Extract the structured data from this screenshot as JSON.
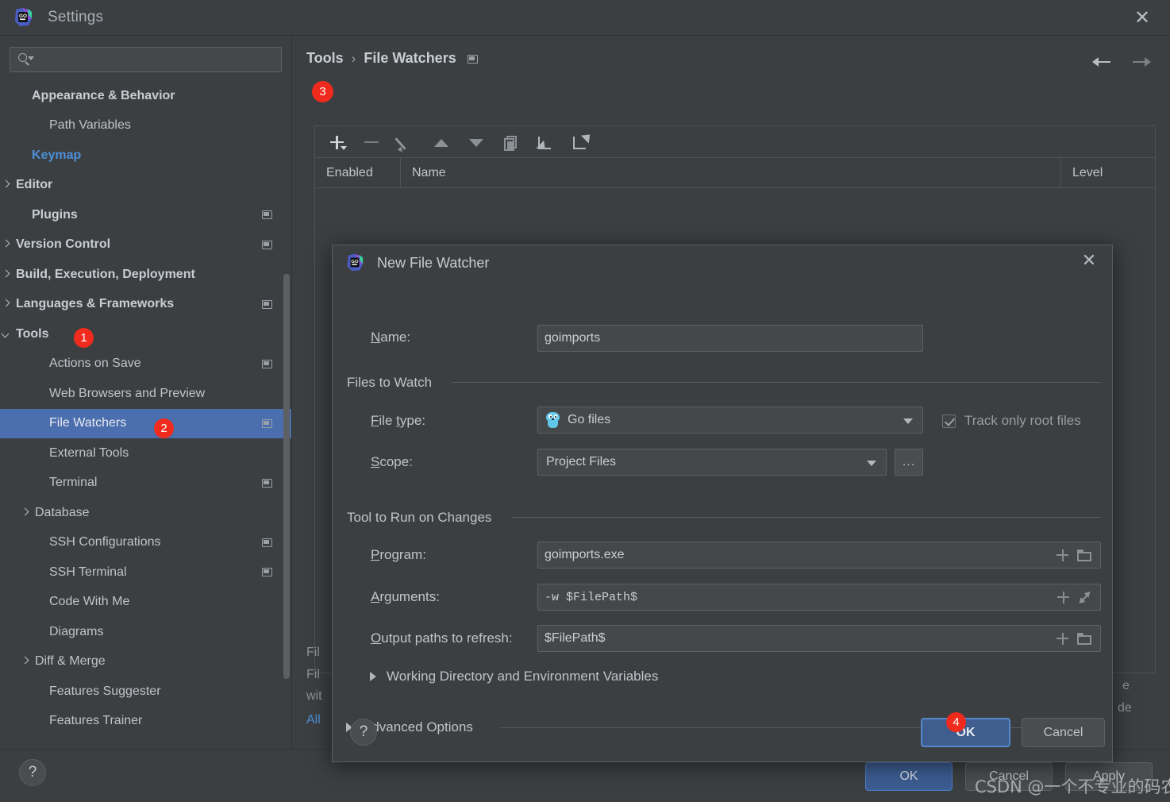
{
  "window": {
    "title": "Settings",
    "logo_icon": "goland-logo-icon",
    "close_icon": "close-icon"
  },
  "sidebar": {
    "search": {
      "placeholder": "",
      "value": "",
      "icon": "search-icon"
    },
    "items": [
      {
        "label": "Appearance & Behavior",
        "style": "bold",
        "arrow": "none",
        "indent": 30,
        "badge": false
      },
      {
        "label": "Path Variables",
        "style": "normal",
        "arrow": "none",
        "indent": 52,
        "badge": false
      },
      {
        "label": "Keymap",
        "style": "link",
        "arrow": "none",
        "indent": 30,
        "badge": false
      },
      {
        "label": "Editor",
        "style": "bold",
        "arrow": "right",
        "indent": 10,
        "badge": false
      },
      {
        "label": "Plugins",
        "style": "bold",
        "arrow": "none",
        "indent": 30,
        "badge": true
      },
      {
        "label": "Version Control",
        "style": "bold",
        "arrow": "right",
        "indent": 10,
        "badge": true
      },
      {
        "label": "Build, Execution, Deployment",
        "style": "bold",
        "arrow": "right",
        "indent": 10,
        "badge": false
      },
      {
        "label": "Languages & Frameworks",
        "style": "bold",
        "arrow": "right",
        "indent": 10,
        "badge": true
      },
      {
        "label": "Tools",
        "style": "bold",
        "arrow": "down",
        "indent": 10,
        "badge": false,
        "step": "1"
      },
      {
        "label": "Actions on Save",
        "style": "normal",
        "arrow": "none",
        "indent": 52,
        "badge": true
      },
      {
        "label": "Web Browsers and Preview",
        "style": "normal",
        "arrow": "none",
        "indent": 52,
        "badge": false
      },
      {
        "label": "File Watchers",
        "style": "normal",
        "arrow": "none",
        "indent": 52,
        "badge": true,
        "selected": true,
        "step": "2"
      },
      {
        "label": "External Tools",
        "style": "normal",
        "arrow": "none",
        "indent": 52,
        "badge": false
      },
      {
        "label": "Terminal",
        "style": "normal",
        "arrow": "none",
        "indent": 52,
        "badge": true
      },
      {
        "label": "Database",
        "style": "normal",
        "arrow": "right",
        "indent": 34,
        "badge": false
      },
      {
        "label": "SSH Configurations",
        "style": "normal",
        "arrow": "none",
        "indent": 52,
        "badge": true
      },
      {
        "label": "SSH Terminal",
        "style": "normal",
        "arrow": "none",
        "indent": 52,
        "badge": true
      },
      {
        "label": "Code With Me",
        "style": "normal",
        "arrow": "none",
        "indent": 52,
        "badge": false
      },
      {
        "label": "Diagrams",
        "style": "normal",
        "arrow": "none",
        "indent": 52,
        "badge": false
      },
      {
        "label": "Diff & Merge",
        "style": "normal",
        "arrow": "right",
        "indent": 34,
        "badge": false
      },
      {
        "label": "Features Suggester",
        "style": "normal",
        "arrow": "none",
        "indent": 52,
        "badge": false
      },
      {
        "label": "Features Trainer",
        "style": "normal",
        "arrow": "none",
        "indent": 52,
        "badge": false
      }
    ]
  },
  "breadcrumb": {
    "root": "Tools",
    "separator": "›",
    "current": "File Watchers"
  },
  "nav": {
    "back_icon": "arrow-left-icon",
    "forward_icon": "arrow-right-icon"
  },
  "toolbar": {
    "step": "3",
    "buttons": [
      {
        "name": "add-watcher-button",
        "icon": "plus-dropdown-icon",
        "enabled": true
      },
      {
        "name": "remove-watcher-button",
        "icon": "minus-icon",
        "enabled": false
      },
      {
        "name": "edit-watcher-button",
        "icon": "pencil-icon",
        "enabled": false
      },
      {
        "name": "move-up-button",
        "icon": "triangle-up-icon",
        "enabled": false
      },
      {
        "name": "move-down-button",
        "icon": "triangle-down-icon",
        "enabled": false
      },
      {
        "name": "copy-watcher-button",
        "icon": "copy-icon",
        "enabled": false
      },
      {
        "name": "import-button",
        "icon": "import-arrow-icon",
        "enabled": true
      },
      {
        "name": "export-button",
        "icon": "export-arrow-icon",
        "enabled": true
      }
    ]
  },
  "table": {
    "columns": [
      "Enabled",
      "Name",
      "Level"
    ],
    "rows": []
  },
  "background_text": {
    "line1": "Fil",
    "line2": "Fil",
    "line3": "wit",
    "link": "All",
    "right1": "e",
    "right2": "de"
  },
  "dialog": {
    "title": "New File Watcher",
    "logo_icon": "goland-logo-icon",
    "close_icon": "close-icon",
    "name_label": "Name:",
    "name_value": "goimports",
    "files_to_watch": {
      "section_title": "Files to Watch",
      "file_type_label": "File type:",
      "file_type_value": "Go files",
      "file_type_icon": "go-gopher-icon",
      "scope_label": "Scope:",
      "scope_value": "Project Files",
      "browse_label": "...",
      "track_root_label": "Track only root files",
      "track_root_checked": true
    },
    "tool_to_run": {
      "section_title": "Tool to Run on Changes",
      "program_label": "Program:",
      "program_value": "goimports.exe",
      "arguments_label": "Arguments:",
      "arguments_value": "-w $FilePath$",
      "output_label": "Output paths to refresh:",
      "output_value": "$FilePath$"
    },
    "working_dir_label": "Working Directory and Environment Variables",
    "advanced_label": "Advanced Options",
    "help_label": "?",
    "ok_label": "OK",
    "cancel_label": "Cancel",
    "ok_step": "4"
  },
  "bottom": {
    "help_label": "?",
    "ok_label": "OK",
    "cancel_label": "Cancel",
    "apply_label": "Apply"
  },
  "watermark": "CSDN @一个不专业的码农",
  "colors": {
    "window_bg": "#3c3f41",
    "selection_blue": "#4b6eaf",
    "link_blue": "#4d90d8",
    "badge_red": "#f02b1d",
    "primary_button": "#3c5d93"
  }
}
